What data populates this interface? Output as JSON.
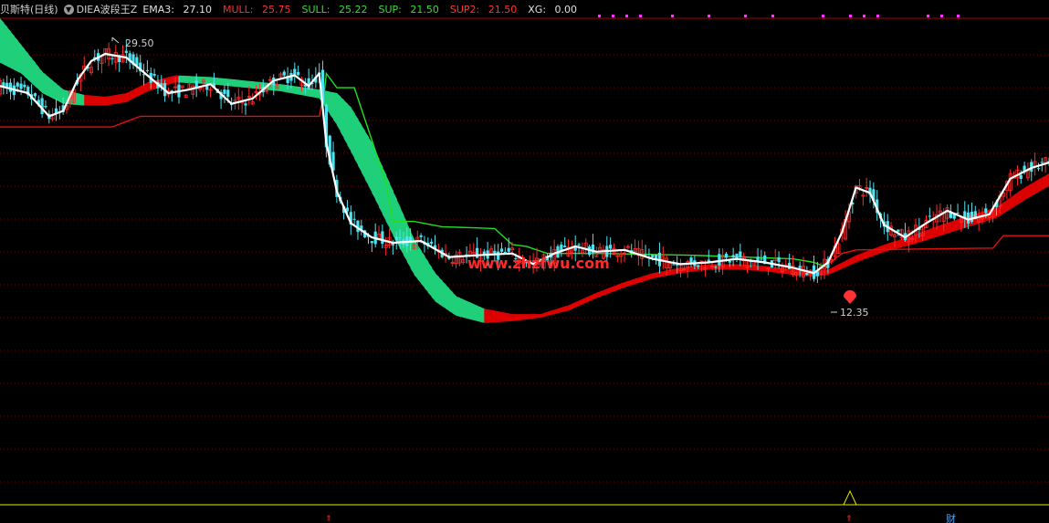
{
  "header": {
    "title": "贝斯特(日线)",
    "indicator_name": "DIEA波段王Z",
    "fields": [
      {
        "label": "EMA3:",
        "value": "27.10",
        "color": "#e0e0e0"
      },
      {
        "label": "MULL:",
        "value": "25.75",
        "color": "#ff3030"
      },
      {
        "label": "SULL:",
        "value": "25.22",
        "color": "#33dd33"
      },
      {
        "label": "SUP:",
        "value": "21.50",
        "color": "#33dd33"
      },
      {
        "label": "SUP2:",
        "value": "21.50",
        "color": "#ff3030"
      },
      {
        "label": "XG:",
        "value": "0.00",
        "color": "#e0e0e0"
      }
    ]
  },
  "annotations": {
    "high_label": "29.50",
    "low_label": "12.35",
    "watermark": "www.zhzfwu.com",
    "bottom_char": "财"
  },
  "colors": {
    "background": "#000000",
    "up_candle": "#ff2a2a",
    "down_candle": "#4de3f0",
    "ema": "#ffffff",
    "ribbon_bear": "#1fcf7a",
    "ribbon_bull": "#dd0000",
    "resistance": "#22dd22",
    "support": "#dd1111",
    "grid": "#7a0000",
    "signal_line": "#e8e800",
    "dots": "#ff33ff"
  },
  "chart_data": {
    "type": "candlestick",
    "title": "贝斯特(日线)",
    "indicator": "DIEA波段王Z",
    "ylim": [
      10.0,
      31.0
    ],
    "x_count": 300,
    "series_last_values": {
      "EMA3": 27.1,
      "MULL": 25.75,
      "SULL": 25.22,
      "SUP": 21.5,
      "SUP2": 21.5,
      "XG": 0.0
    },
    "extrema": [
      {
        "type": "high",
        "price": 29.5,
        "x": 30
      },
      {
        "type": "low",
        "price": 12.35,
        "x": 234
      }
    ],
    "ema_path": [
      [
        0,
        27.2
      ],
      [
        8,
        26.8
      ],
      [
        14,
        25.5
      ],
      [
        18,
        25.8
      ],
      [
        22,
        27.5
      ],
      [
        26,
        28.6
      ],
      [
        30,
        29.0
      ],
      [
        36,
        28.8
      ],
      [
        42,
        27.8
      ],
      [
        48,
        26.8
      ],
      [
        54,
        27.0
      ],
      [
        60,
        27.3
      ],
      [
        66,
        26.2
      ],
      [
        72,
        26.5
      ],
      [
        78,
        27.5
      ],
      [
        84,
        27.8
      ],
      [
        88,
        27.2
      ],
      [
        91,
        27.9
      ],
      [
        93,
        24.0
      ],
      [
        96,
        21.3
      ],
      [
        100,
        19.5
      ],
      [
        106,
        18.7
      ],
      [
        112,
        18.4
      ],
      [
        120,
        18.5
      ],
      [
        128,
        17.6
      ],
      [
        136,
        17.7
      ],
      [
        146,
        17.8
      ],
      [
        152,
        17.2
      ],
      [
        158,
        17.8
      ],
      [
        164,
        18.2
      ],
      [
        170,
        17.9
      ],
      [
        178,
        18.0
      ],
      [
        186,
        17.5
      ],
      [
        194,
        17.2
      ],
      [
        202,
        17.3
      ],
      [
        210,
        17.5
      ],
      [
        218,
        17.3
      ],
      [
        226,
        17.0
      ],
      [
        232,
        16.7
      ],
      [
        236,
        17.3
      ],
      [
        240,
        19.0
      ],
      [
        244,
        21.5
      ],
      [
        248,
        21.2
      ],
      [
        252,
        19.4
      ],
      [
        258,
        18.7
      ],
      [
        264,
        19.5
      ],
      [
        270,
        20.2
      ],
      [
        276,
        19.7
      ],
      [
        282,
        20.0
      ],
      [
        288,
        22.0
      ],
      [
        294,
        22.6
      ],
      [
        299,
        22.9
      ]
    ],
    "ribbon_upper": [
      [
        0,
        31.0
      ],
      [
        6,
        29.5
      ],
      [
        12,
        28.0
      ],
      [
        18,
        27.0
      ],
      [
        24,
        26.7
      ],
      [
        30,
        26.6
      ],
      [
        36,
        26.8
      ],
      [
        42,
        27.4
      ],
      [
        50,
        27.8
      ],
      [
        60,
        27.7
      ],
      [
        70,
        27.5
      ],
      [
        80,
        27.3
      ],
      [
        91,
        27.0
      ],
      [
        96,
        26.8
      ],
      [
        100,
        26.0
      ],
      [
        106,
        24.0
      ],
      [
        112,
        21.3
      ],
      [
        118,
        18.6
      ],
      [
        124,
        16.7
      ],
      [
        130,
        15.4
      ],
      [
        138,
        14.7
      ],
      [
        146,
        14.4
      ],
      [
        154,
        14.4
      ],
      [
        162,
        14.9
      ],
      [
        170,
        15.6
      ],
      [
        178,
        16.2
      ],
      [
        186,
        16.7
      ],
      [
        194,
        17.0
      ],
      [
        202,
        17.2
      ],
      [
        210,
        17.2
      ],
      [
        218,
        17.1
      ],
      [
        226,
        16.9
      ],
      [
        232,
        16.8
      ],
      [
        236,
        16.9
      ],
      [
        244,
        17.7
      ],
      [
        252,
        18.3
      ],
      [
        260,
        18.8
      ],
      [
        268,
        19.4
      ],
      [
        276,
        19.9
      ],
      [
        284,
        20.4
      ],
      [
        292,
        21.5
      ],
      [
        299,
        22.3
      ]
    ],
    "ribbon_lower": [
      [
        0,
        28.5
      ],
      [
        6,
        27.9
      ],
      [
        12,
        26.8
      ],
      [
        18,
        26.2
      ],
      [
        24,
        26.1
      ],
      [
        30,
        26.1
      ],
      [
        36,
        26.3
      ],
      [
        42,
        26.9
      ],
      [
        50,
        27.4
      ],
      [
        60,
        27.3
      ],
      [
        70,
        27.1
      ],
      [
        80,
        26.9
      ],
      [
        91,
        26.5
      ],
      [
        96,
        25.0
      ],
      [
        100,
        23.5
      ],
      [
        106,
        21.2
      ],
      [
        112,
        18.8
      ],
      [
        118,
        16.6
      ],
      [
        124,
        15.1
      ],
      [
        130,
        14.3
      ],
      [
        138,
        13.9
      ],
      [
        146,
        14.0
      ],
      [
        154,
        14.2
      ],
      [
        162,
        14.6
      ],
      [
        170,
        15.3
      ],
      [
        178,
        15.9
      ],
      [
        186,
        16.4
      ],
      [
        194,
        16.7
      ],
      [
        202,
        16.9
      ],
      [
        210,
        16.9
      ],
      [
        218,
        16.8
      ],
      [
        226,
        16.6
      ],
      [
        232,
        16.5
      ],
      [
        236,
        16.6
      ],
      [
        244,
        17.3
      ],
      [
        252,
        17.9
      ],
      [
        260,
        18.3
      ],
      [
        268,
        18.8
      ],
      [
        276,
        19.3
      ],
      [
        284,
        19.8
      ],
      [
        292,
        20.8
      ],
      [
        299,
        21.6
      ]
    ],
    "bull_from_x": [
      [
        24,
        50
      ],
      [
        138,
        232
      ],
      [
        232,
        299
      ]
    ],
    "resistance_path": [
      [
        92,
        26.0
      ],
      [
        93,
        27.9
      ],
      [
        96,
        27.1
      ],
      [
        101,
        27.1
      ],
      [
        110,
        21.8
      ],
      [
        112,
        19.6
      ],
      [
        118,
        19.6
      ],
      [
        126,
        19.3
      ],
      [
        141,
        19.2
      ],
      [
        146,
        18.3
      ],
      [
        150,
        18.2
      ],
      [
        156,
        17.8
      ],
      [
        172,
        17.8
      ],
      [
        198,
        17.7
      ],
      [
        226,
        17.5
      ],
      [
        232,
        17.3
      ],
      [
        236,
        17.0
      ]
    ],
    "support_path": [
      [
        0,
        24.9
      ],
      [
        14,
        24.9
      ],
      [
        32,
        24.9
      ],
      [
        36,
        25.2
      ],
      [
        40,
        25.5
      ],
      [
        56,
        25.5
      ],
      [
        76,
        25.5
      ],
      [
        91,
        25.5
      ],
      [
        92,
        26.5
      ]
    ],
    "support2_path": [
      [
        236,
        17.2
      ],
      [
        240,
        17.8
      ],
      [
        244,
        18.0
      ],
      [
        280,
        18.1
      ],
      [
        283,
        18.1
      ],
      [
        286,
        18.8
      ],
      [
        299,
        18.8
      ]
    ],
    "signal_points": [
      {
        "type": "spike",
        "x": 234
      },
      {
        "type": "marker",
        "x": 92
      },
      {
        "type": "marker",
        "x": 234
      }
    ]
  }
}
